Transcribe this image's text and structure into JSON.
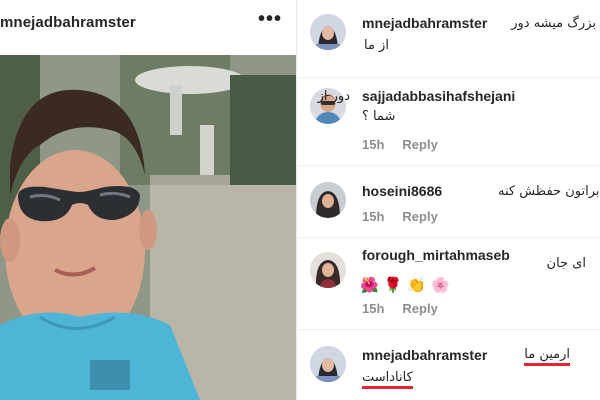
{
  "post": {
    "username": "mnejadbahramster",
    "more_icon": "more-horizontal-icon"
  },
  "comments": [
    {
      "username": "mnejadbahramster",
      "text_line1": "بزرگ میشه دور",
      "text_line2": "از ما"
    },
    {
      "username": "sajjadabbasihafshejani",
      "text_line1": "دور از",
      "text_line2": "شما ؟",
      "time": "15h",
      "reply": "Reply"
    },
    {
      "username": "hoseini8686",
      "text_line1": "خدابراتون حفظش کنه",
      "time": "15h",
      "reply": "Reply"
    },
    {
      "username": "forough_mirtahmaseb",
      "text_line1": "ای جان",
      "emojis": [
        "🌺",
        "🌹",
        "👏",
        "🌸"
      ],
      "time": "15h",
      "reply": "Reply"
    },
    {
      "username": "mnejadbahramster",
      "text_line1": "ارمین ما",
      "text_line2": "کاناداست"
    }
  ],
  "colors": {
    "accent_underline": "#e3262f",
    "meta_gray": "#8e8e8e",
    "text": "#262626"
  }
}
